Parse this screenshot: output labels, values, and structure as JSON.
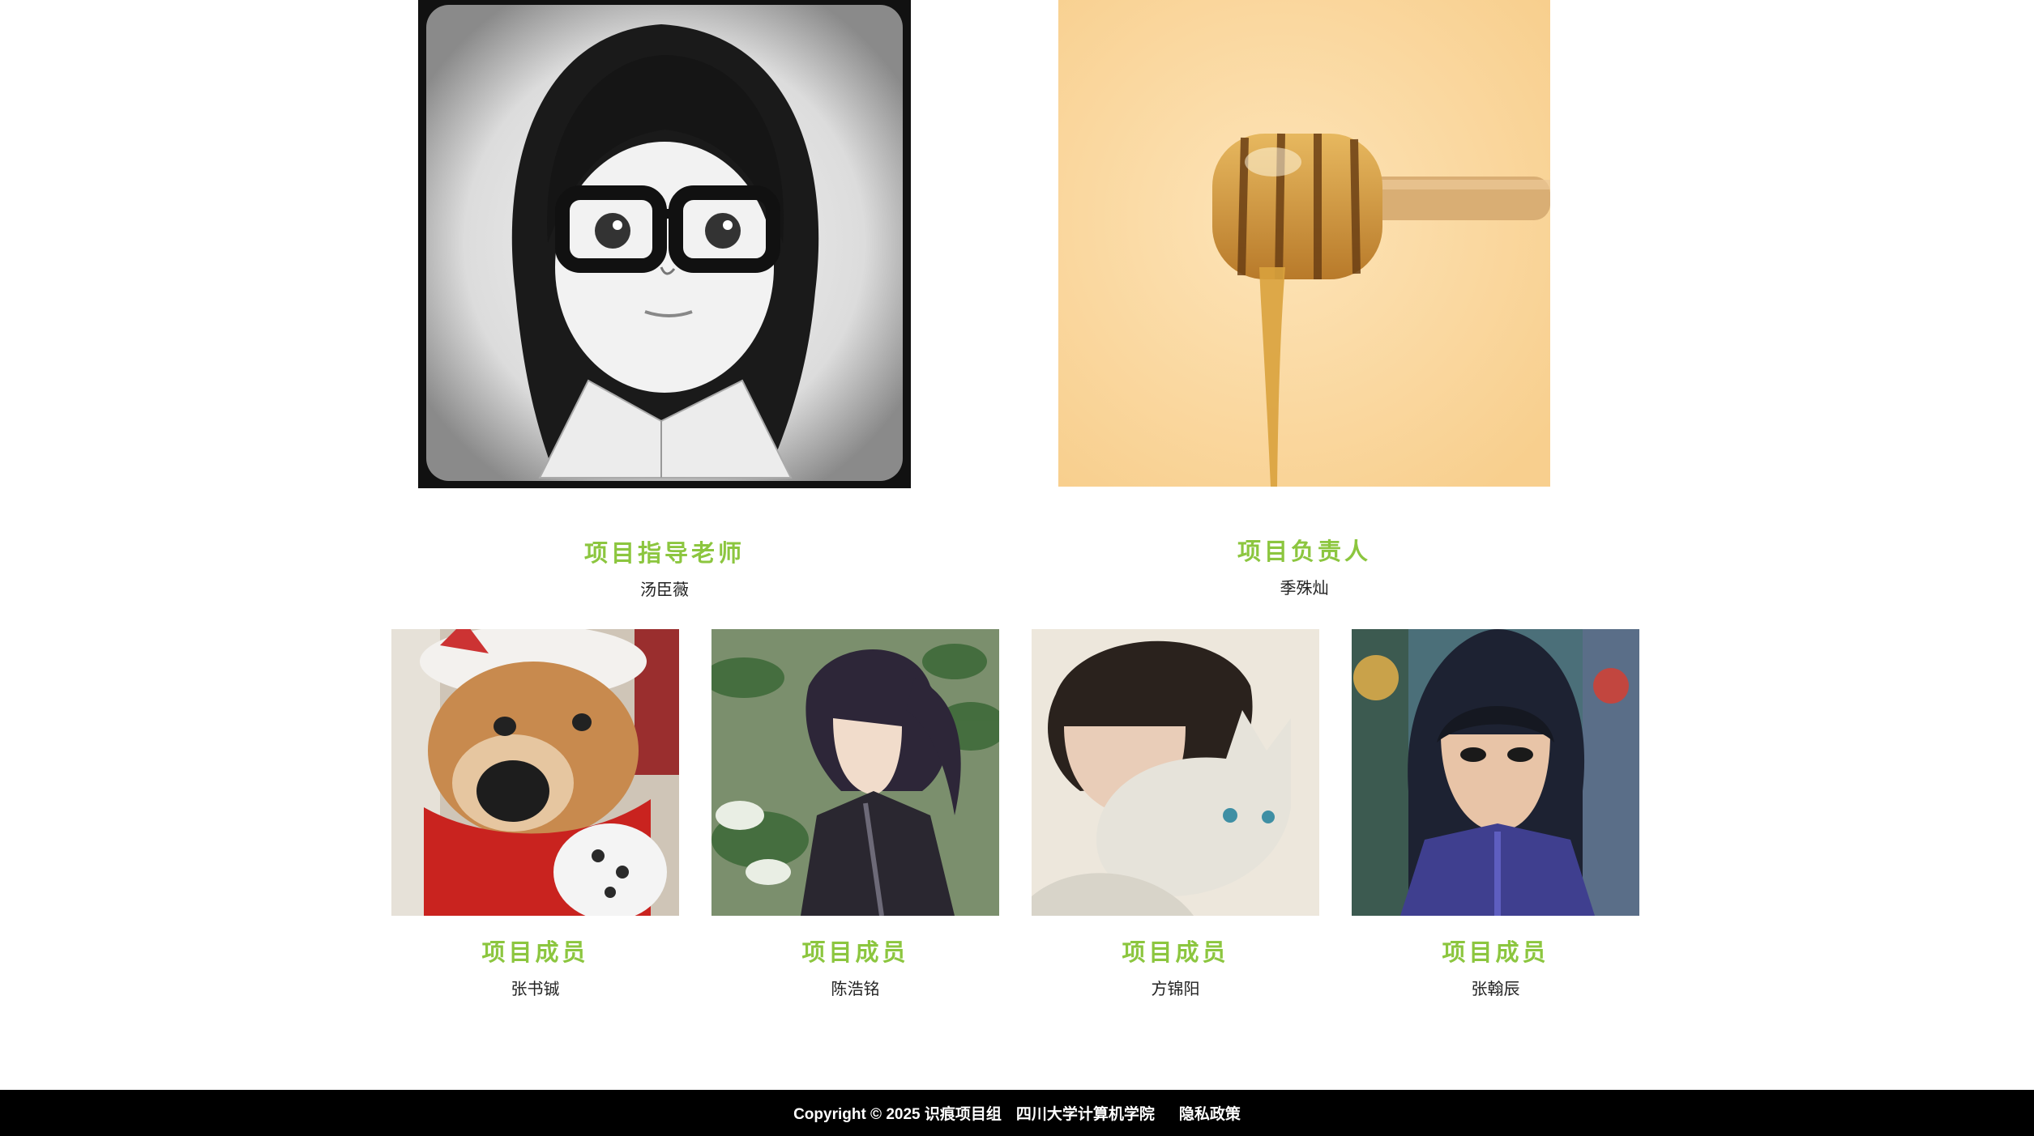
{
  "team": {
    "leaders": [
      {
        "role": "项目指导老师",
        "name": "汤臣薇",
        "photo": "cartoon-girl-glasses-portrait"
      },
      {
        "role": "项目负责人",
        "name": "季殊灿",
        "photo": "honey-dipper-photo"
      }
    ],
    "members": [
      {
        "role": "项目成员",
        "name": "张书铖",
        "photo": "dog-in-hat-and-scarf"
      },
      {
        "role": "项目成员",
        "name": "陈浩铭",
        "photo": "anime-boy-ponytail"
      },
      {
        "role": "项目成员",
        "name": "方锦阳",
        "photo": "anime-boy-with-cat"
      },
      {
        "role": "项目成员",
        "name": "张翰辰",
        "photo": "anime-boy-hood"
      }
    ]
  },
  "footer": {
    "copyright": "Copyright © 2025 识痕项目组",
    "school": "四川大学计算机学院",
    "privacy_link": "隐私政策"
  },
  "colors": {
    "accent_green": "#8cc63f",
    "footer_bg": "#000000"
  }
}
